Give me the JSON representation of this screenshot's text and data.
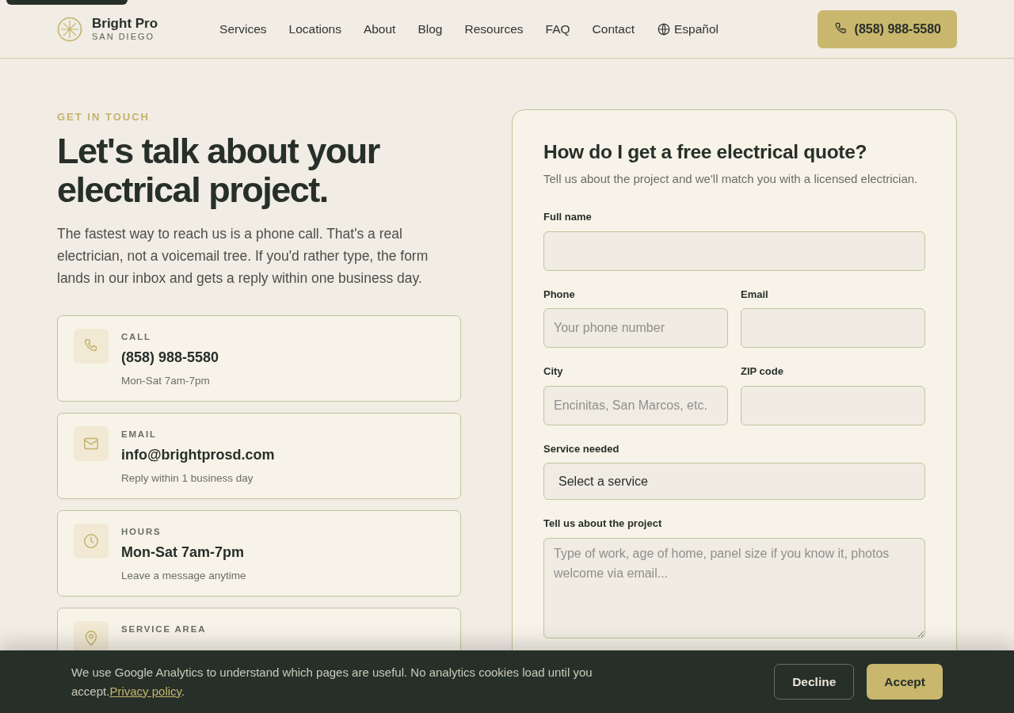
{
  "header": {
    "brand": {
      "name": "Bright Pro",
      "tagline": "SAN DIEGO"
    },
    "nav": [
      {
        "label": "Services",
        "kind": "link"
      },
      {
        "label": "Locations",
        "kind": "link"
      },
      {
        "label": "About",
        "kind": "link"
      },
      {
        "label": "Blog",
        "kind": "link"
      },
      {
        "label": "Resources",
        "kind": "link"
      },
      {
        "label": "FAQ",
        "kind": "link"
      },
      {
        "label": "Contact",
        "kind": "link"
      },
      {
        "label": "Español",
        "kind": "language"
      }
    ],
    "phone_button": "(858) 988-5580"
  },
  "intro": {
    "eyebrow": "GET IN TOUCH",
    "title": "Let's talk about your electrical project.",
    "lead": "The fastest way to reach us is a phone call. That's a real electrician, not a voicemail tree. If you'd rather type, the form lands in our inbox and gets a reply within one business day."
  },
  "contact_cards": [
    {
      "kind": "phone",
      "label": "CALL",
      "value": "(858) 988-5580",
      "note": "Mon-Sat 7am-7pm"
    },
    {
      "kind": "email",
      "label": "EMAIL",
      "value": "info@brightprosd.com",
      "note": "Reply within 1 business day"
    },
    {
      "kind": "clock",
      "label": "HOURS",
      "value": "Mon-Sat 7am-7pm",
      "note": "Leave a message anytime"
    },
    {
      "kind": "pin",
      "label": "SERVICE AREA"
    }
  ],
  "quote_form": {
    "title": "How do I get a free electrical quote?",
    "subtitle": "Tell us about the project and we'll match you with a licensed electrician.",
    "rows": [
      [
        {
          "kind": "text",
          "label": "Full name"
        }
      ],
      [
        {
          "kind": "text",
          "label": "Phone",
          "placeholder": "Your phone number"
        },
        {
          "kind": "text",
          "label": "Email"
        }
      ],
      [
        {
          "kind": "text",
          "label": "City",
          "placeholder": "Encinitas, San Marcos, etc."
        },
        {
          "kind": "text",
          "label": "ZIP code"
        }
      ],
      [
        {
          "kind": "select",
          "label": "Service needed",
          "value": "Select a service"
        }
      ],
      [
        {
          "kind": "textarea",
          "label": "Tell us about the project",
          "placeholder": "Type of work, age of home, panel size if you know it, photos welcome via email..."
        }
      ]
    ]
  },
  "cookie_banner": {
    "text": "We use Google Analytics to understand which pages are useful. No analytics cookies load until you accept.",
    "link": "Privacy policy",
    "end": ".",
    "buttons": [
      {
        "kind": "secondary",
        "label": "Decline"
      },
      {
        "kind": "primary",
        "label": "Accept"
      }
    ]
  }
}
